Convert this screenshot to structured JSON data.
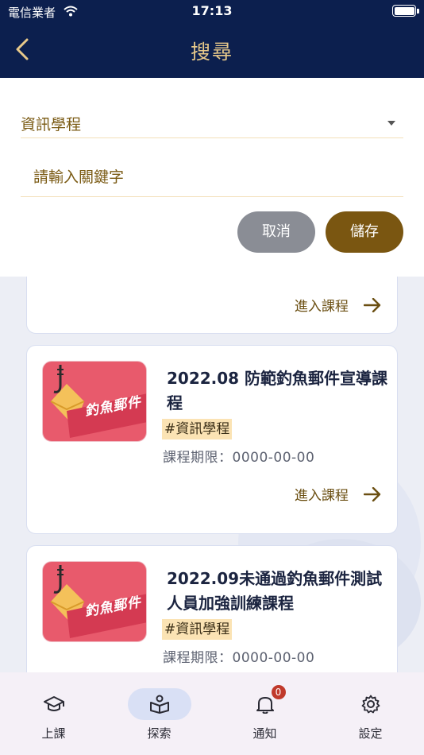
{
  "status_bar": {
    "carrier": "電信業者",
    "time": "17:13"
  },
  "nav": {
    "title": "搜尋",
    "back_icon": "chevron-left-icon"
  },
  "search": {
    "category": "資訊學程",
    "keyword_placeholder": "請輸入關鍵字",
    "cancel_label": "取消",
    "save_label": "儲存"
  },
  "courses": [
    {
      "enter_label": "進入課程"
    },
    {
      "thumb_label": "釣魚郵件",
      "title": " 2022.08 防範釣魚郵件宣導課程",
      "tag": "#資訊學程",
      "deadline": "課程期限：0000-00-00",
      "enter_label": "進入課程"
    },
    {
      "thumb_label": "釣魚郵件",
      "title": " 2022.09未通過釣魚郵件測試人員加強訓練課程",
      "tag": "#資訊學程",
      "deadline": "課程期限：0000-00-00"
    }
  ],
  "tabs": [
    {
      "label": "上課",
      "icon": "graduation-cap-icon",
      "active": false
    },
    {
      "label": "探索",
      "icon": "open-book-icon",
      "active": true
    },
    {
      "label": "通知",
      "icon": "bell-icon",
      "badge": "0",
      "active": false
    },
    {
      "label": "設定",
      "icon": "gear-icon",
      "active": false
    }
  ],
  "colors": {
    "nav_bg": "#0c1f4e",
    "nav_title": "#e8c98a",
    "accent_gold": "#7a5611",
    "cancel_gray": "#8a8d95",
    "tag_bg": "#fbe3b4",
    "active_tab_bg": "#d9e0f5"
  }
}
